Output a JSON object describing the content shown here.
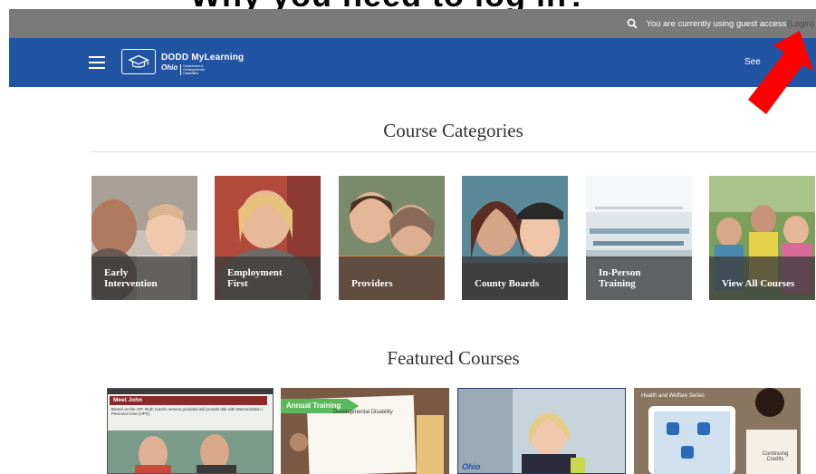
{
  "top_banner_text": "Why you need to log in?",
  "guest_bar": {
    "search_icon": "search-icon",
    "guest_text": "You are currently using guest access",
    "login_text": "(Login)"
  },
  "navbar": {
    "menu_icon": "hamburger-icon",
    "logo_icon": "graduation-cap-laptop-icon",
    "logo_title": "DODD MyLearning",
    "logo_ohio": "Ohio",
    "logo_dept": "Department of Developmental Disabilities",
    "right_link": "See"
  },
  "sections": {
    "categories_title": "Course Categories",
    "featured_title": "Featured Courses"
  },
  "categories": [
    {
      "label": "Early\nIntervention"
    },
    {
      "label": "Employment\nFirst"
    },
    {
      "label": "Providers"
    },
    {
      "label": "County Boards"
    },
    {
      "label": "In-Person\nTraining"
    },
    {
      "label": "View All Courses"
    }
  ],
  "featured": [
    {
      "title": "Meet John",
      "blurb": "Based on the ISP, Ruth Carol's service provided will provide title with Memorization / Personal Care (HPC)"
    },
    {
      "badge": "Annual Training",
      "note": "Developmental Disability"
    },
    {
      "logo": "Ohio"
    },
    {
      "heading": "Health and Welfare Series",
      "note": "Continuing Credits"
    }
  ],
  "colors": {
    "guest_bar": "#7a7a7a",
    "navbar": "#2155a3",
    "arrow": "#ff0000",
    "badge": "#5cb85c"
  }
}
